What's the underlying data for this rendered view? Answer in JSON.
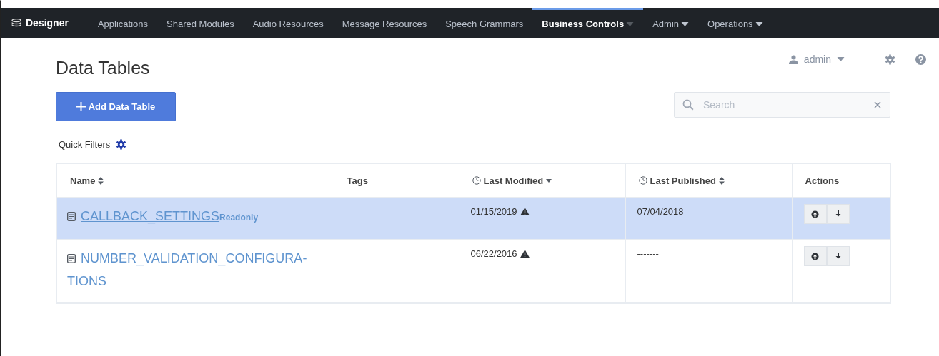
{
  "nav": {
    "brand": "Designer",
    "items": [
      {
        "label": "Applications",
        "selected": false,
        "dropdown": false
      },
      {
        "label": "Shared Modules",
        "selected": false,
        "dropdown": false
      },
      {
        "label": "Audio Resources",
        "selected": false,
        "dropdown": false
      },
      {
        "label": "Message Resources",
        "selected": false,
        "dropdown": false
      },
      {
        "label": "Speech Grammars",
        "selected": false,
        "dropdown": false
      },
      {
        "label": "Business Controls",
        "selected": true,
        "dropdown": true
      },
      {
        "label": "Admin",
        "selected": false,
        "dropdown": true
      },
      {
        "label": "Operations",
        "selected": false,
        "dropdown": true
      }
    ]
  },
  "user": {
    "name": "admin"
  },
  "page": {
    "title": "Data Tables",
    "add_button": "Add Data Table",
    "search": {
      "placeholder": "Search"
    },
    "quick_filters": "Quick Filters"
  },
  "table": {
    "columns": [
      {
        "label": "Name",
        "kind": "plain",
        "sortable": true,
        "sorted_descending": false
      },
      {
        "label": "Tags",
        "kind": "plain",
        "sortable": false
      },
      {
        "label": "Last Modified",
        "kind": "date",
        "sortable": true,
        "sorted_descending": true
      },
      {
        "label": "Last Published",
        "kind": "date",
        "sortable": true,
        "sorted_descending": false
      },
      {
        "label": "Actions",
        "kind": "plain",
        "sortable": false
      }
    ],
    "rows": [
      {
        "name": "CALLBACK_SETTINGS",
        "underlined": true,
        "badge": "Readonly",
        "selected": true,
        "last_modified": "01/15/2019",
        "modified_warning": true,
        "last_published": "07/04/2018"
      },
      {
        "name": "NUMBER_VALIDATION_CONFIGURA-TIONS",
        "underlined": false,
        "selected": false,
        "last_modified": "06/22/2016",
        "modified_warning": true,
        "last_published": "-------"
      }
    ]
  }
}
